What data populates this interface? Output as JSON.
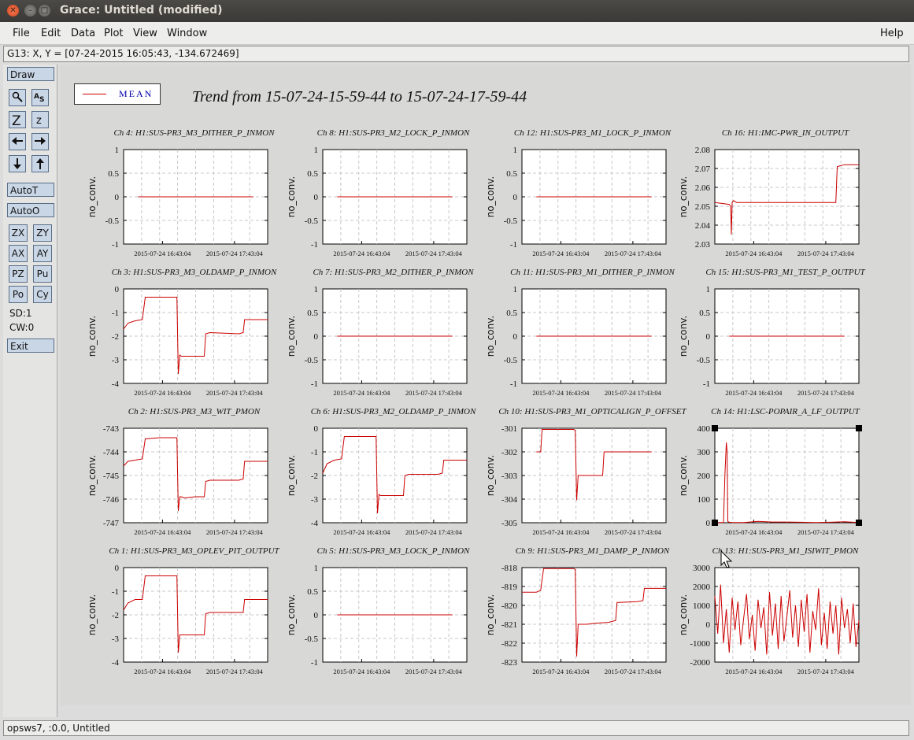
{
  "window": {
    "title": "Grace: Untitled (modified)"
  },
  "menu": {
    "file": "File",
    "edit": "Edit",
    "data": "Data",
    "plot": "Plot",
    "view": "View",
    "window": "Window",
    "help": "Help"
  },
  "locator": "G13: X, Y = [07-24-2015 16:05:43, -134.672469]",
  "tools": {
    "draw": "Draw",
    "autot": "AutoT",
    "autoo": "AutoO",
    "zx": "ZX",
    "zy": "ZY",
    "ax": "AX",
    "ay": "AY",
    "pz": "PZ",
    "pu": "Pu",
    "po": "Po",
    "cy": "Cy",
    "sd": "SD:1",
    "cw": "CW:0",
    "exit": "Exit",
    "icons": [
      "zoom-icon",
      "autoscale-text-icon",
      "zoom-in-icon",
      "zoom-out-icon",
      "scroll-left-icon",
      "scroll-right-icon",
      "scroll-down-icon",
      "scroll-up-icon"
    ]
  },
  "status": "opsws7, :0.0, Untitled",
  "legend": {
    "label": "MEAN",
    "color": "#cc0000"
  },
  "main_title": "Trend from 15-07-24-15-59-44 to 15-07-24-17-59-44",
  "chart_data": [
    {
      "type": "line",
      "title": "Ch 4: H1:SUS-PR3_M3_DITHER_P_INMON",
      "ylabel": "no_conv.",
      "ylim": [
        -1,
        1
      ],
      "yticks": [
        "-1",
        "-0.5",
        "0",
        "0.5",
        "1"
      ],
      "xticks": [
        "2015-07-24 16:43:04",
        "2015-07-24 17:43:04"
      ],
      "x": [
        0.1,
        0.9
      ],
      "values": [
        0,
        0
      ]
    },
    {
      "type": "line",
      "title": "Ch 8: H1:SUS-PR3_M2_LOCK_P_INMON",
      "ylabel": "no_conv.",
      "ylim": [
        -1,
        1
      ],
      "yticks": [
        "-1",
        "-0.5",
        "0",
        "0.5",
        "1"
      ],
      "xticks": [
        "2015-07-24 16:43:04",
        "2015-07-24 17:43:04"
      ],
      "x": [
        0.1,
        0.9
      ],
      "values": [
        0,
        0
      ]
    },
    {
      "type": "line",
      "title": "Ch 12: H1:SUS-PR3_M1_LOCK_P_INMON",
      "ylabel": "no_conv.",
      "ylim": [
        -1,
        1
      ],
      "yticks": [
        "-1",
        "-0.5",
        "0",
        "0.5",
        "1"
      ],
      "xticks": [
        "2015-07-24 16:43:04",
        "2015-07-24 17:43:04"
      ],
      "x": [
        0.1,
        0.9
      ],
      "values": [
        0,
        0
      ]
    },
    {
      "type": "line",
      "title": "Ch 16: H1:IMC-PWR_IN_OUTPUT",
      "ylabel": "no_conv.",
      "ylim": [
        2.03,
        2.08
      ],
      "yticks": [
        "2.03",
        "2.04",
        "2.05",
        "2.06",
        "2.07",
        "2.08"
      ],
      "xticks": [
        "2015-07-24 16:43:04",
        "2015-07-24 17:43:04"
      ],
      "x": [
        0,
        0.1,
        0.11,
        0.115,
        0.12,
        0.13,
        0.15,
        0.2,
        0.3,
        0.4,
        0.5,
        0.6,
        0.7,
        0.8,
        0.84,
        0.85,
        0.9,
        1.0
      ],
      "values": [
        2.052,
        2.051,
        2.05,
        2.035,
        2.052,
        2.053,
        2.052,
        2.052,
        2.052,
        2.052,
        2.052,
        2.052,
        2.052,
        2.052,
        2.052,
        2.071,
        2.072,
        2.072
      ]
    },
    {
      "type": "line",
      "title": "Ch 3: H1:SUS-PR3_M3_OLDAMP_P_INMON",
      "ylabel": "no_conv.",
      "ylim": [
        -4,
        0
      ],
      "yticks": [
        "-4",
        "-3",
        "-2",
        "-1",
        "0"
      ],
      "xticks": [
        "2015-07-24 16:43:04",
        "2015-07-24 17:43:04"
      ],
      "x": [
        0,
        0.03,
        0.08,
        0.13,
        0.15,
        0.25,
        0.37,
        0.38,
        0.39,
        0.4,
        0.42,
        0.5,
        0.56,
        0.57,
        0.6,
        0.8,
        0.83,
        0.84,
        1.0
      ],
      "values": [
        -1.7,
        -1.45,
        -1.35,
        -1.3,
        -0.35,
        -0.35,
        -0.35,
        -3.6,
        -2.8,
        -2.85,
        -2.85,
        -2.85,
        -2.85,
        -1.9,
        -1.85,
        -1.9,
        -1.85,
        -1.3,
        -1.3
      ]
    },
    {
      "type": "line",
      "title": "Ch 7: H1:SUS-PR3_M2_DITHER_P_INMON",
      "ylabel": "no_conv.",
      "ylim": [
        -1,
        1
      ],
      "yticks": [
        "-1",
        "-0.5",
        "0",
        "0.5",
        "1"
      ],
      "xticks": [
        "2015-07-24 16:43:04",
        "2015-07-24 17:43:04"
      ],
      "x": [
        0.1,
        0.9
      ],
      "values": [
        0,
        0
      ]
    },
    {
      "type": "line",
      "title": "Ch 11: H1:SUS-PR3_M1_DITHER_P_INMON",
      "ylabel": "no_conv.",
      "ylim": [
        -1,
        1
      ],
      "yticks": [
        "-1",
        "-0.5",
        "0",
        "0.5",
        "1"
      ],
      "xticks": [
        "2015-07-24 16:43:04",
        "2015-07-24 17:43:04"
      ],
      "x": [
        0.1,
        0.9
      ],
      "values": [
        0,
        0
      ]
    },
    {
      "type": "line",
      "title": "Ch 15: H1:SUS-PR3_M1_TEST_P_OUTPUT",
      "ylabel": "no_conv.",
      "ylim": [
        -1,
        1
      ],
      "yticks": [
        "-1",
        "-0.5",
        "0",
        "0.5",
        "1"
      ],
      "xticks": [
        "2015-07-24 16:43:04",
        "2015-07-24 17:43:04"
      ],
      "x": [
        0.1,
        0.9
      ],
      "values": [
        0,
        0
      ]
    },
    {
      "type": "line",
      "title": "Ch 2: H1:SUS-PR3_M3_WIT_PMON",
      "ylabel": "no_conv.",
      "ylim": [
        -747,
        -743
      ],
      "yticks": [
        "-747",
        "-746",
        "-745",
        "-744",
        "-743"
      ],
      "xticks": [
        "2015-07-24 16:43:04",
        "2015-07-24 17:43:04"
      ],
      "x": [
        0,
        0.03,
        0.08,
        0.13,
        0.15,
        0.25,
        0.37,
        0.38,
        0.39,
        0.4,
        0.42,
        0.5,
        0.56,
        0.57,
        0.6,
        0.8,
        0.83,
        0.84,
        1.0
      ],
      "values": [
        -744.6,
        -744.4,
        -744.35,
        -744.3,
        -743.45,
        -743.4,
        -743.4,
        -746.5,
        -745.9,
        -745.9,
        -745.95,
        -745.9,
        -745.9,
        -745.25,
        -745.2,
        -745.2,
        -745.15,
        -744.4,
        -744.4
      ]
    },
    {
      "type": "line",
      "title": "Ch 6: H1:SUS-PR3_M2_OLDAMP_P_INMON",
      "ylabel": "no_conv.",
      "ylim": [
        -4,
        0
      ],
      "yticks": [
        "-4",
        "-3",
        "-2",
        "-1",
        "0"
      ],
      "xticks": [
        "2015-07-24 16:43:04",
        "2015-07-24 17:43:04"
      ],
      "x": [
        0,
        0.03,
        0.08,
        0.13,
        0.15,
        0.25,
        0.37,
        0.38,
        0.39,
        0.4,
        0.42,
        0.5,
        0.56,
        0.57,
        0.6,
        0.8,
        0.83,
        0.84,
        1.0
      ],
      "values": [
        -1.9,
        -1.5,
        -1.35,
        -1.3,
        -0.35,
        -0.35,
        -0.35,
        -3.6,
        -2.8,
        -2.85,
        -2.85,
        -2.85,
        -2.85,
        -2.0,
        -1.95,
        -1.95,
        -1.9,
        -1.35,
        -1.35
      ]
    },
    {
      "type": "line",
      "title": "Ch 10: H1:SUS-PR3_M1_OPTICALIGN_P_OFFSET",
      "ylabel": "no_conv.",
      "ylim": [
        -305,
        -301
      ],
      "yticks": [
        "-305",
        "-304",
        "-303",
        "-302",
        "-301"
      ],
      "xticks": [
        "2015-07-24 16:43:04",
        "2015-07-24 17:43:04"
      ],
      "x": [
        0.1,
        0.13,
        0.14,
        0.36,
        0.37,
        0.38,
        0.39,
        0.56,
        0.57,
        0.9
      ],
      "values": [
        -302,
        -302,
        -301.05,
        -301.05,
        -301.1,
        -304.05,
        -303,
        -303,
        -302,
        -302
      ]
    },
    {
      "type": "line",
      "title": "Ch 14: H1:LSC-POPAIR_A_LF_OUTPUT",
      "ylabel": "no_conv.",
      "ylim": [
        0,
        400
      ],
      "yticks": [
        "0",
        "100",
        "200",
        "300",
        "400"
      ],
      "xticks": [
        "2015-07-24 16:43:04",
        "2015-07-24 17:43:04"
      ],
      "x": [
        0,
        0.04,
        0.06,
        0.07,
        0.08,
        0.085,
        0.09,
        0.1,
        0.12,
        0.2,
        0.3,
        0.4,
        0.5,
        0.6,
        0.7,
        0.8,
        0.9,
        1.0
      ],
      "values": [
        0,
        1,
        1,
        200,
        340,
        300,
        5,
        2,
        1,
        1,
        6,
        3,
        3,
        2,
        1,
        2,
        4,
        1
      ]
    },
    {
      "type": "line",
      "title": "Ch 1: H1:SUS-PR3_M3_OPLEV_PIT_OUTPUT",
      "ylabel": "no_conv.",
      "ylim": [
        -4,
        0
      ],
      "yticks": [
        "-4",
        "-3",
        "-2",
        "-1",
        "0"
      ],
      "xticks": [
        "2015-07-24 16:43:04",
        "2015-07-24 17:43:04"
      ],
      "x": [
        0,
        0.03,
        0.08,
        0.13,
        0.15,
        0.25,
        0.37,
        0.38,
        0.39,
        0.4,
        0.42,
        0.5,
        0.56,
        0.57,
        0.6,
        0.8,
        0.83,
        0.84,
        1.0
      ],
      "values": [
        -1.8,
        -1.5,
        -1.35,
        -1.35,
        -0.35,
        -0.35,
        -0.35,
        -3.6,
        -2.85,
        -2.85,
        -2.85,
        -2.85,
        -2.85,
        -1.95,
        -1.9,
        -1.9,
        -1.9,
        -1.35,
        -1.35
      ]
    },
    {
      "type": "line",
      "title": "Ch 5: H1:SUS-PR3_M3_LOCK_P_INMON",
      "ylabel": "no_conv.",
      "ylim": [
        -1,
        1
      ],
      "yticks": [
        "-1",
        "-0.5",
        "0",
        "0.5",
        "1"
      ],
      "xticks": [
        "2015-07-24 16:43:04",
        "2015-07-24 17:43:04"
      ],
      "x": [
        0.1,
        0.9
      ],
      "values": [
        0,
        0
      ]
    },
    {
      "type": "line",
      "title": "Ch 9: H1:SUS-PR3_M1_DAMP_P_INMON",
      "ylabel": "no_conv.",
      "ylim": [
        -823,
        -818
      ],
      "yticks": [
        "-823",
        "-822",
        "-821",
        "-820",
        "-819",
        "-818"
      ],
      "xticks": [
        "2015-07-24 16:43:04",
        "2015-07-24 17:43:04"
      ],
      "x": [
        0,
        0.08,
        0.1,
        0.13,
        0.15,
        0.25,
        0.36,
        0.37,
        0.38,
        0.39,
        0.45,
        0.5,
        0.6,
        0.65,
        0.66,
        0.8,
        0.84,
        0.85,
        0.9,
        1.0
      ],
      "values": [
        -819.3,
        -819.3,
        -819.3,
        -819.2,
        -818.05,
        -818.05,
        -818.05,
        -818.1,
        -822.7,
        -821.0,
        -821.0,
        -820.95,
        -820.9,
        -820.8,
        -819.85,
        -819.8,
        -819.75,
        -819.1,
        -819.1,
        -819.1
      ]
    },
    {
      "type": "line",
      "title": "Ch 13: H1:SUS-PR3_M1_ISIWIT_PMON",
      "ylabel": "no_conv.",
      "ylim": [
        -2000,
        3000
      ],
      "yticks": [
        "-2000",
        "-1000",
        "0",
        "1000",
        "2000",
        "3000"
      ],
      "xticks": [
        "2015-07-24 16:43:04",
        "2015-07-24 17:43:04"
      ],
      "x": [
        0,
        0.02,
        0.04,
        0.06,
        0.08,
        0.1,
        0.12,
        0.14,
        0.16,
        0.18,
        0.2,
        0.22,
        0.24,
        0.26,
        0.28,
        0.3,
        0.32,
        0.34,
        0.36,
        0.38,
        0.4,
        0.42,
        0.44,
        0.46,
        0.48,
        0.5,
        0.52,
        0.54,
        0.56,
        0.58,
        0.6,
        0.62,
        0.64,
        0.66,
        0.68,
        0.7,
        0.72,
        0.74,
        0.76,
        0.78,
        0.8,
        0.82,
        0.84,
        0.86,
        0.88,
        0.9,
        0.92,
        0.94,
        0.96,
        0.98,
        1.0
      ],
      "values": [
        1500,
        -500,
        2100,
        -1000,
        800,
        -1500,
        1400,
        -300,
        1200,
        -1100,
        300,
        1600,
        -800,
        500,
        -1400,
        1300,
        -200,
        900,
        -1600,
        1700,
        -600,
        1100,
        -1300,
        1500,
        -900,
        400,
        1800,
        -700,
        1000,
        -1200,
        1300,
        -400,
        1600,
        -1500,
        700,
        -300,
        1900,
        -1100,
        600,
        -1300,
        1200,
        -500,
        1000,
        -1600,
        1400,
        -200,
        800,
        -1000,
        1100,
        -1200,
        200
      ]
    }
  ]
}
